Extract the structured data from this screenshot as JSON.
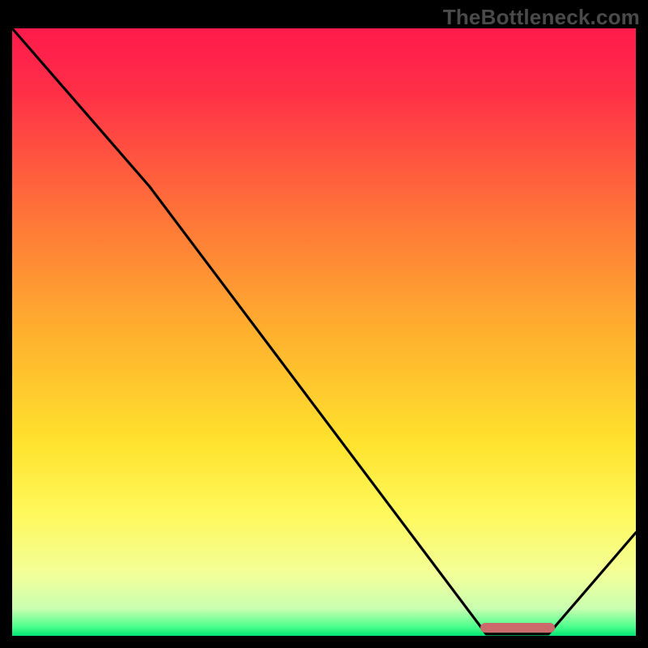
{
  "watermark": {
    "text": "TheBottleneck.com"
  },
  "chart_data": {
    "type": "line",
    "title": "",
    "xlabel": "",
    "ylabel": "",
    "xlim": [
      0,
      100
    ],
    "ylim": [
      0,
      100
    ],
    "grid": false,
    "legend": false,
    "background_gradient_stops": [
      {
        "offset": 0.0,
        "color": "#ff1a4b"
      },
      {
        "offset": 0.1,
        "color": "#ff2e48"
      },
      {
        "offset": 0.28,
        "color": "#ff6b3a"
      },
      {
        "offset": 0.5,
        "color": "#ffb02e"
      },
      {
        "offset": 0.68,
        "color": "#ffe22d"
      },
      {
        "offset": 0.8,
        "color": "#fff95c"
      },
      {
        "offset": 0.9,
        "color": "#f2ff9a"
      },
      {
        "offset": 0.955,
        "color": "#c9ffb0"
      },
      {
        "offset": 0.985,
        "color": "#4cff8c"
      },
      {
        "offset": 1.0,
        "color": "#00e572"
      }
    ],
    "series": [
      {
        "name": "bottleneck-curve",
        "color": "#000000",
        "points": [
          {
            "x": 0,
            "y": 100
          },
          {
            "x": 22,
            "y": 74
          },
          {
            "x": 76,
            "y": 0.3
          },
          {
            "x": 86,
            "y": 0.3
          },
          {
            "x": 100,
            "y": 17
          }
        ]
      }
    ],
    "annotations": {
      "optimal_marker": {
        "x_start": 75,
        "x_end": 87,
        "color": "#cb6a6a"
      }
    }
  }
}
